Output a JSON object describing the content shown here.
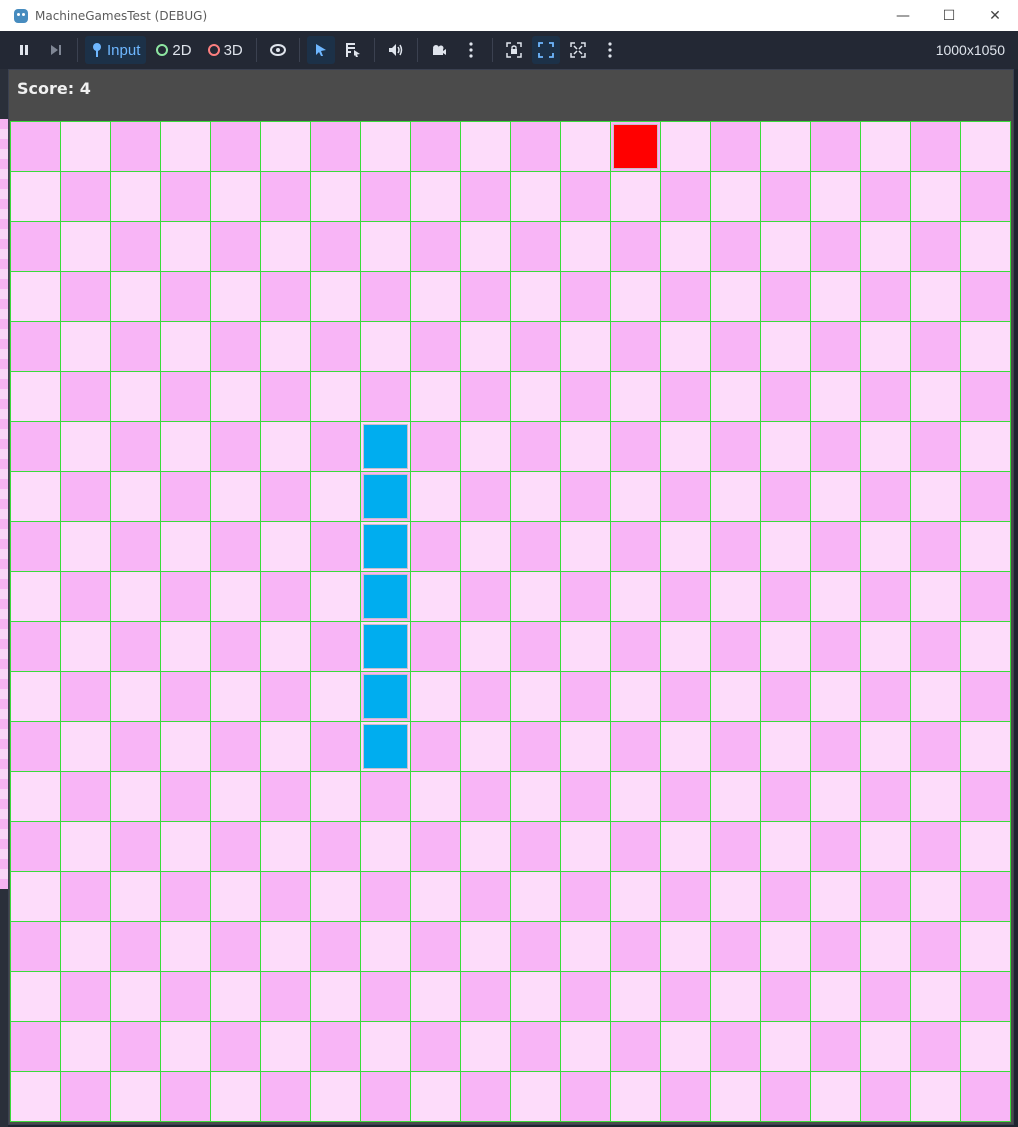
{
  "window": {
    "title": "MachineGamesTest (DEBUG)",
    "minimize_glyph": "—",
    "maximize_glyph": "☐",
    "close_glyph": "✕"
  },
  "toolbar": {
    "pause_icon": "pause-icon",
    "step_icon": "next-frame-icon",
    "input_label": "Input",
    "mode_2d_label": "2D",
    "mode_3d_label": "3D",
    "resolution": "1000x1050"
  },
  "game": {
    "score_text": "Score: 4",
    "grid": {
      "cols": 20,
      "rows": 20
    },
    "colors": {
      "cell_dark": "#f8b5f6",
      "cell_light": "#fddcfa",
      "grid_line": "#3adb3a",
      "snake": "#00adef",
      "food": "#ff0000"
    },
    "food": {
      "col": 12,
      "row": 0
    },
    "snake": [
      {
        "col": 7,
        "row": 6
      },
      {
        "col": 7,
        "row": 7
      },
      {
        "col": 7,
        "row": 8
      },
      {
        "col": 7,
        "row": 9
      },
      {
        "col": 7,
        "row": 10
      },
      {
        "col": 7,
        "row": 11
      },
      {
        "col": 7,
        "row": 12
      }
    ]
  }
}
